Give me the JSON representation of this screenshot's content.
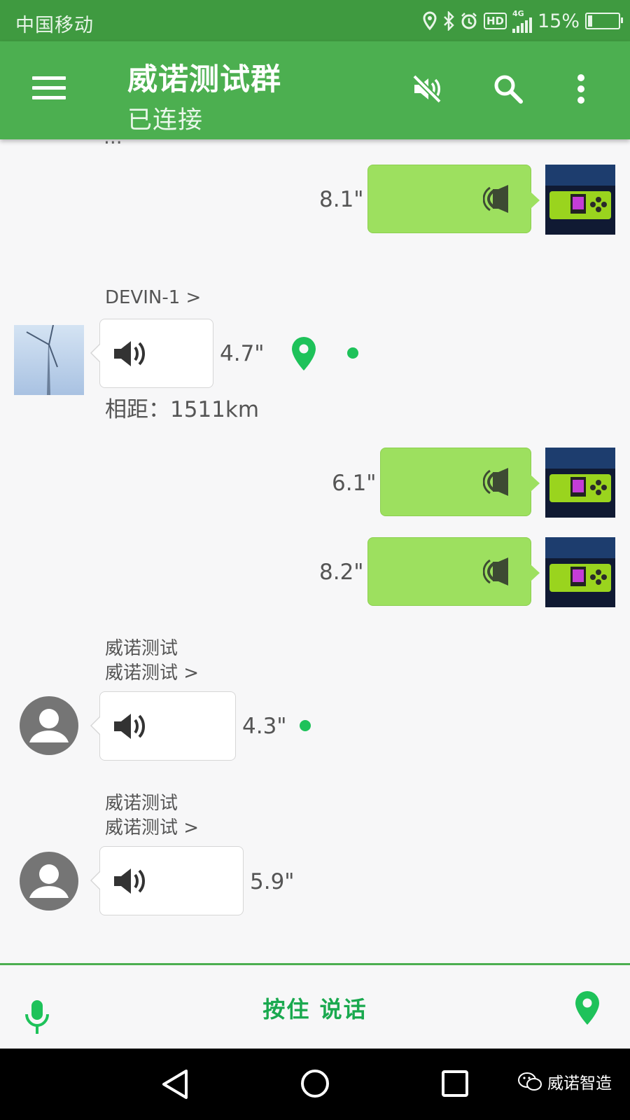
{
  "status_bar": {
    "carrier": "中国移动",
    "network": "4G",
    "hd": "HD",
    "battery": "15%",
    "battery_level": 0.15
  },
  "app_bar": {
    "title": "威诺测试群",
    "subtitle": "已连接"
  },
  "messages": [
    {
      "dir": "out",
      "duration": "8.1\""
    },
    {
      "dir": "in",
      "sender": "DEVIN-1 >",
      "duration": "4.7\"",
      "distance": "相距：1511km"
    },
    {
      "dir": "out",
      "duration": "6.1\""
    },
    {
      "dir": "out",
      "duration": "8.2\""
    },
    {
      "dir": "in",
      "sender_line1": "威诺测试",
      "sender_line2": "威诺测试 >",
      "duration": "4.3\""
    },
    {
      "dir": "in",
      "sender_line1": "威诺测试",
      "sender_line2": "威诺测试 >",
      "duration": "5.9\""
    }
  ],
  "bottom_bar": {
    "push_to_talk": "按住 说话"
  },
  "watermark": "威诺智造",
  "colors": {
    "primary": "#4caf50",
    "status": "#3f9a40",
    "bubble_out": "#9de05f",
    "accent": "#1aa94f",
    "unread_dot": "#1ec25a"
  },
  "icons": [
    "menu-icon",
    "mute-icon",
    "search-icon",
    "more-vert-icon",
    "speaker-icon",
    "location-pin-icon",
    "mic-icon",
    "avatar-person-icon",
    "back-triangle-icon",
    "home-circle-icon",
    "recents-square-icon"
  ]
}
